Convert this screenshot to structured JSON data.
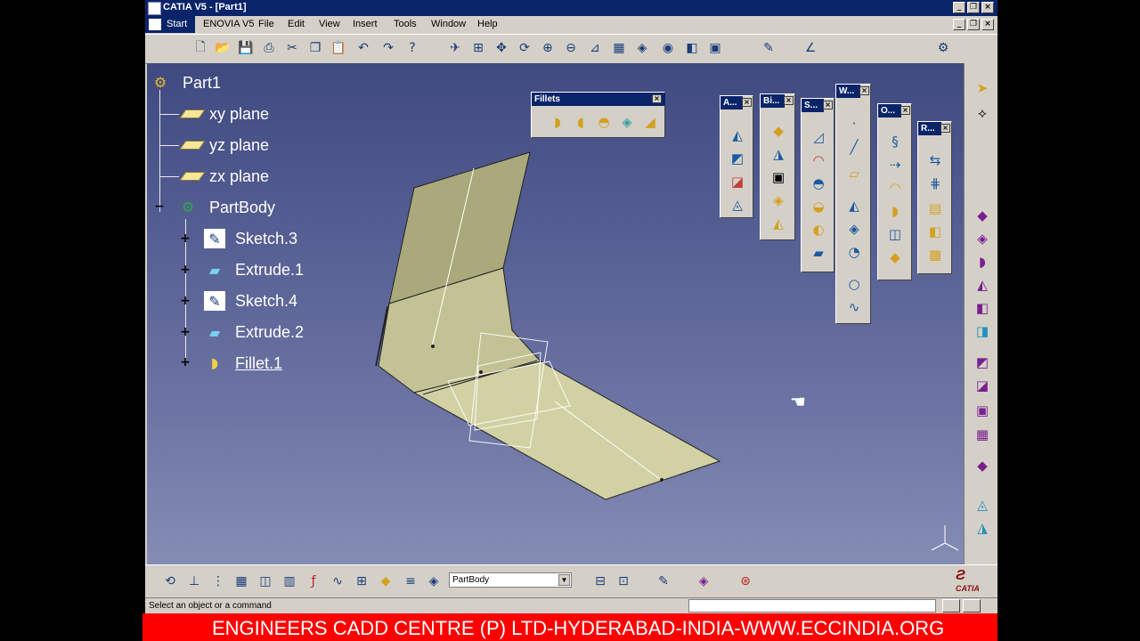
{
  "window": {
    "title": "CATIA V5 - [Part1]"
  },
  "menu": {
    "items": [
      "Start",
      "ENOVIA V5",
      "File",
      "Edit",
      "View",
      "Insert",
      "Tools",
      "Window",
      "Help"
    ]
  },
  "tree": {
    "root": "Part1",
    "planes": [
      "xy plane",
      "yz plane",
      "zx plane"
    ],
    "body": "PartBody",
    "features": [
      "Sketch.3",
      "Extrude.1",
      "Sketch.4",
      "Extrude.2",
      "Fillet.1"
    ]
  },
  "toolbars": {
    "fillets": {
      "title": "Fillets"
    },
    "floating_titles": [
      "A...",
      "Bi...",
      "S...",
      "W...",
      "O...",
      "R..."
    ]
  },
  "bottom": {
    "body_selector": "PartBody",
    "logo": "CATIA"
  },
  "status": {
    "message": "Select an object or a command"
  },
  "banner": {
    "text": "ENGINEERS CADD CENTRE (P) LTD-HYDERABAD-INDIA-WWW.ECCINDIA.ORG"
  },
  "colors": {
    "titlebar": "#0a246a",
    "viewport_top": "#3f4a80",
    "viewport_bottom": "#858cb4",
    "surface": "#c8c79a",
    "banner": "#ff0000"
  }
}
